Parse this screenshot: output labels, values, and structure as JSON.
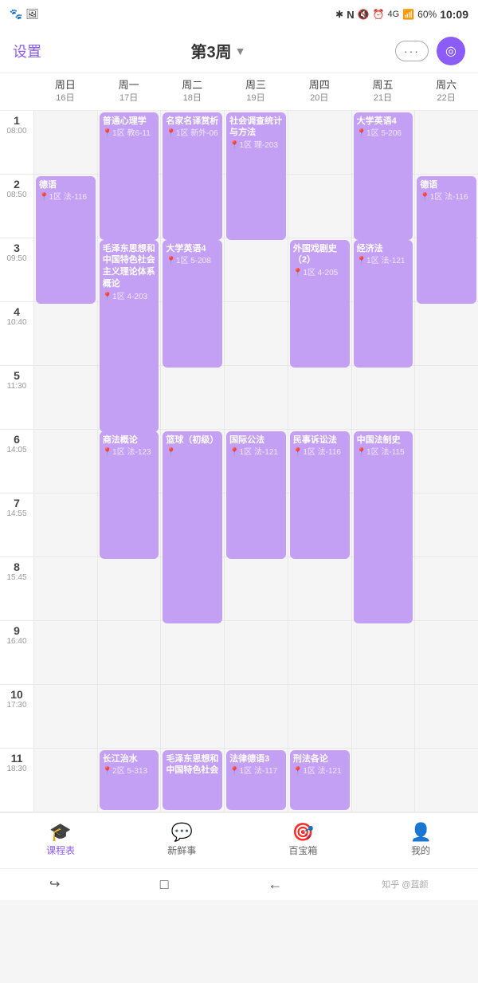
{
  "statusBar": {
    "icons_left": "📷 🖼️",
    "bluetooth": "🔷",
    "signal": "N",
    "battery_pct": "60%",
    "time": "10:09"
  },
  "header": {
    "settings_label": "设置",
    "week_label": "第3周",
    "chevron": "▼",
    "dots_label": "···",
    "target_icon": "◎"
  },
  "days": [
    {
      "name": "周日",
      "date": "16日"
    },
    {
      "name": "周一",
      "date": "17日"
    },
    {
      "name": "周二",
      "date": "18日"
    },
    {
      "name": "周三",
      "date": "19日"
    },
    {
      "name": "周四",
      "date": "20日"
    },
    {
      "name": "周五",
      "date": "21日"
    },
    {
      "name": "周六",
      "date": "22日"
    }
  ],
  "periods": [
    {
      "num": "1",
      "time": "08:00"
    },
    {
      "num": "2",
      "time": "08:50"
    },
    {
      "num": "3",
      "time": "09:50"
    },
    {
      "num": "4",
      "time": "10:40"
    },
    {
      "num": "5",
      "time": "11:30"
    },
    {
      "num": "6",
      "time": "14:05"
    },
    {
      "num": "7",
      "time": "14:55"
    },
    {
      "num": "8",
      "time": "15:45"
    },
    {
      "num": "9",
      "time": "16:40"
    },
    {
      "num": "10",
      "time": "17:30"
    },
    {
      "num": "11",
      "time": "18:30"
    }
  ],
  "courses": {
    "mon_p1": {
      "name": "普通心理学",
      "info": "📍1区 教6-11",
      "span": 2
    },
    "mon_p3": {
      "name": "毛泽东思想和中国特色社会主义理论体系概论",
      "info": "📍1区 4-203",
      "span": 3
    },
    "mon_p6": {
      "name": "商法概论",
      "info": "📍1区 法-123",
      "span": 2
    },
    "mon_p11": {
      "name": "长江治水",
      "info": "📍2区 5-313",
      "span": 1
    },
    "tue_p1": {
      "name": "名家名译赏析",
      "info": "📍1区 新外-06",
      "span": 2
    },
    "tue_p3": {
      "name": "大学英语4",
      "info": "📍1区 5-208",
      "span": 2
    },
    "tue_p6": {
      "name": "篮球（初级）",
      "info": "📍",
      "span": 3
    },
    "tue_p11": {
      "name": "毛泽东思想和中国特色社会主义",
      "info": "",
      "span": 1
    },
    "wed_p1": {
      "name": "社会调查统计与方法",
      "info": "📍1区 理-203",
      "span": 2
    },
    "wed_p6": {
      "name": "国际公法",
      "info": "📍1区 法-121",
      "span": 2
    },
    "wed_p11": {
      "name": "法律德语3",
      "info": "📍1区 法-117",
      "span": 1
    },
    "thu_p3": {
      "name": "外国戏剧史（2）",
      "info": "📍1区 4-205",
      "span": 2
    },
    "thu_p6": {
      "name": "民事诉讼法",
      "info": "📍1区 法-116",
      "span": 2
    },
    "thu_p11": {
      "name": "刑法各论",
      "info": "📍1区 法-121",
      "span": 1
    },
    "fri_p1": {
      "name": "大学英语4",
      "info": "📍1区 5-206",
      "span": 2
    },
    "fri_p3": {
      "name": "经济法",
      "info": "📍1区 法-121",
      "span": 2
    },
    "fri_p6": {
      "name": "中国法制史",
      "info": "📍1区 法-115",
      "span": 3
    },
    "sat_p2": {
      "name": "德语",
      "info": "📍1区 法-116",
      "span": 2
    },
    "sun_p2": {
      "name": "德语",
      "info": "📍1区 法-116",
      "span": 2
    }
  },
  "bottomNav": [
    {
      "id": "schedule",
      "icon": "🎓",
      "label": "课程表",
      "active": true
    },
    {
      "id": "news",
      "icon": "💬",
      "label": "新鲜事",
      "active": false
    },
    {
      "id": "toolbox",
      "icon": "🎯",
      "label": "百宝箱",
      "active": false
    },
    {
      "id": "profile",
      "icon": "👤",
      "label": "我的",
      "active": false
    }
  ],
  "sysNav": {
    "back": "↩",
    "home": "□",
    "recent": "←"
  },
  "watermark": "知乎 @蓝颜"
}
